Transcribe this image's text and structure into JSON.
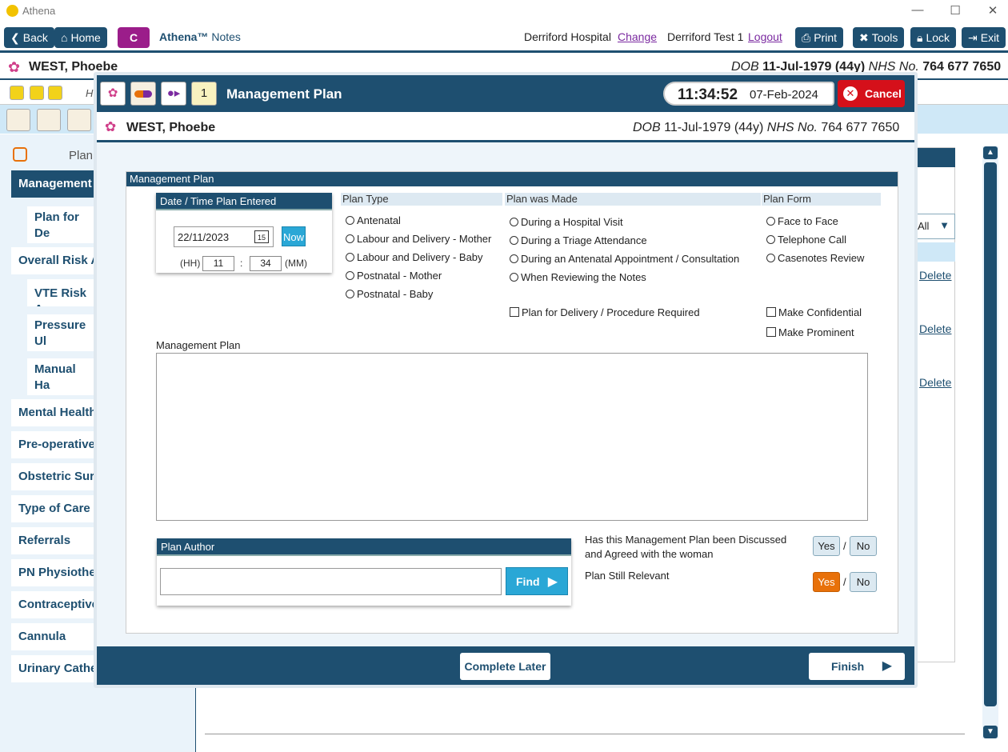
{
  "window": {
    "title": "Athena",
    "minimize": "—",
    "maximize": "☐",
    "close": "✕"
  },
  "toolbar": {
    "back": "Back",
    "home": "Home",
    "c_label": "C",
    "app_brand": "Athena™",
    "app_name": "Notes",
    "hospital": "Derriford Hospital",
    "change": "Change",
    "user": "Derriford Test 1",
    "logout": "Logout",
    "print": "Print",
    "tools": "Tools",
    "lock": "Lock",
    "exit": "Exit"
  },
  "patient": {
    "name": "WEST, Phoebe",
    "dob_label": "DOB",
    "dob": "11-Jul-1979 (44y)",
    "nhs_label": "NHS No.",
    "nhs": "764 677 7650"
  },
  "background": {
    "nav_header": "Plan",
    "nav": [
      "Management",
      "Plan for De Procedure",
      "Overall Risk A",
      "VTE Risk As",
      "Pressure Ul Assessmen",
      "Manual Ha Assessmen",
      "Mental Health",
      "Pre-operative",
      "Obstetric Surg",
      "Type of Care",
      "Referrals",
      "PN Physiother",
      "Contraceptive",
      "Cannula",
      "Urinary Cathe"
    ],
    "delete": "Delete",
    "filter": "All",
    "h_partial": "H"
  },
  "modal": {
    "title": "Management Plan",
    "time": "11:34:52",
    "date": "07-Feb-2024",
    "cancel": "Cancel",
    "section_title": "Management Plan",
    "date_box": {
      "header": "Date / Time Plan Entered",
      "date_value": "22/11/2023",
      "cal_day": "15",
      "now": "Now",
      "hh_label": "(HH)",
      "hh": "11",
      "sep": ":",
      "mm": "34",
      "mm_label": "(MM)"
    },
    "plan_type": {
      "header": "Plan Type",
      "options": [
        "Antenatal",
        "Labour and Delivery - Mother",
        "Labour and Delivery - Baby",
        "Postnatal - Mother",
        "Postnatal - Baby"
      ]
    },
    "plan_made": {
      "header": "Plan was Made",
      "options": [
        "During a Hospital Visit",
        "During a Triage Attendance",
        "During an Antenatal Appointment / Consultation",
        "When Reviewing the Notes"
      ],
      "checkbox": "Plan for Delivery / Procedure Required"
    },
    "plan_form": {
      "header": "Plan Form",
      "options": [
        "Face to Face",
        "Telephone Call",
        "Casenotes Review"
      ],
      "confidential": "Make Confidential",
      "prominent": "Make Prominent"
    },
    "mp_label": "Management Plan",
    "author": {
      "header": "Plan Author",
      "value": "",
      "find": "Find"
    },
    "discussed": {
      "question": "Has this Management Plan been Discussed and Agreed with the woman",
      "yes": "Yes",
      "no": "No",
      "selected": "none"
    },
    "relevant": {
      "question": "Plan Still Relevant",
      "yes": "Yes",
      "no": "No",
      "selected": "yes"
    },
    "complete_later": "Complete Later",
    "finish": "Finish"
  },
  "colors": {
    "primary": "#1e4f70",
    "accent": "#2aa7d6",
    "cancel": "#d5101a",
    "selected": "#e8710a",
    "c_button": "#9b1d8a"
  }
}
